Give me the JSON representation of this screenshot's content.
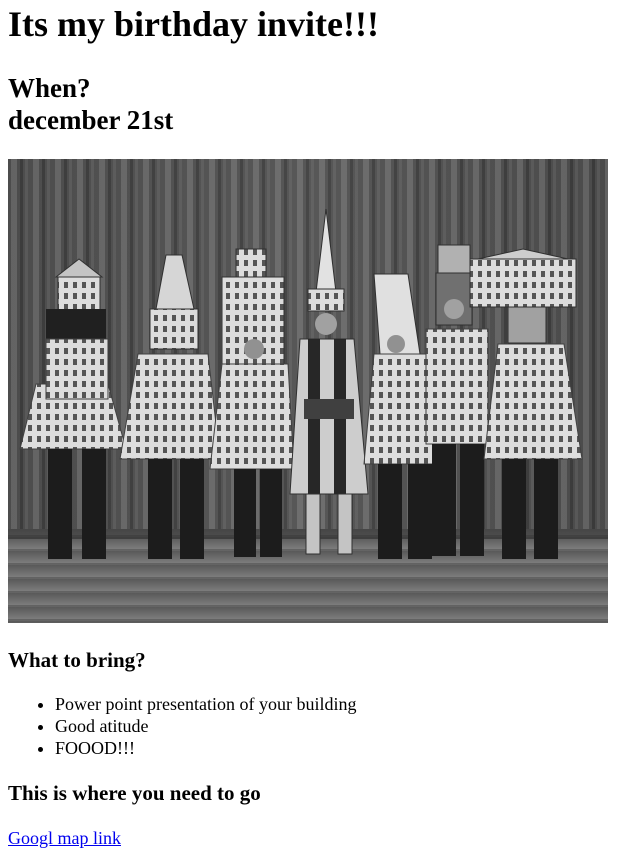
{
  "title": "Its my birthday invite!!!",
  "when": {
    "heading": "When?",
    "date": "december 21st"
  },
  "photo": {
    "alt": "",
    "icon": "photo-image"
  },
  "bring": {
    "heading": "What to bring?",
    "items": [
      "Power point presentation of your building",
      "Good atitude",
      "FOOOD!!!"
    ]
  },
  "where": {
    "heading": "This is where you need to go",
    "link_label": "Googl map link"
  },
  "colors": {
    "link": "#0000ee",
    "text": "#000000",
    "background": "#ffffff"
  }
}
